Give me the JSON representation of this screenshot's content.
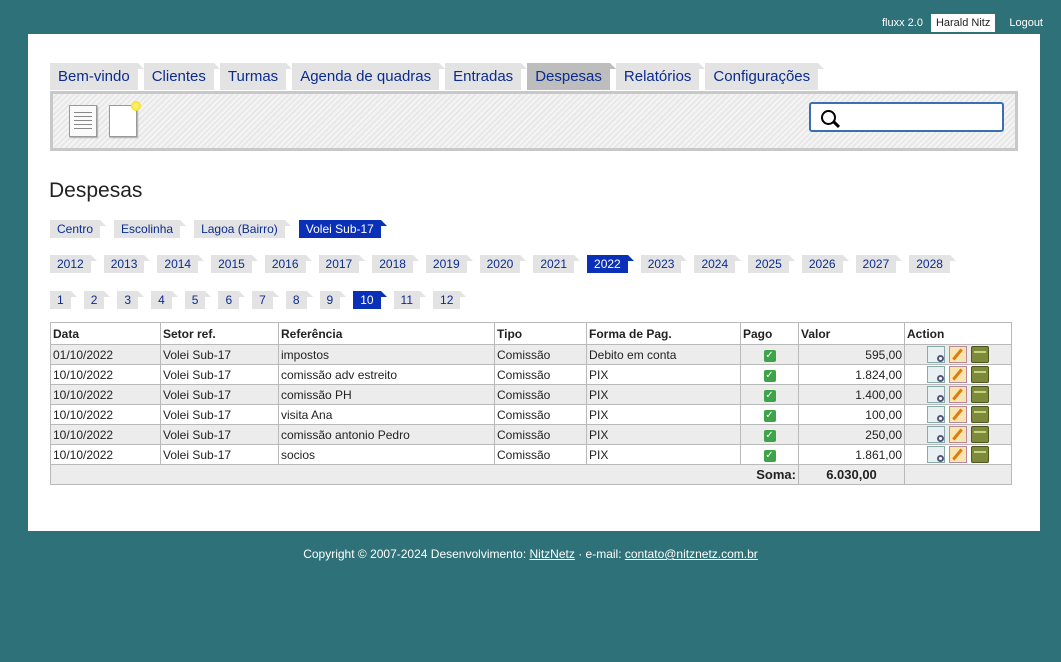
{
  "topbar": {
    "brand": "fluxx 2.0",
    "user": "Harald Nitz",
    "logout": "Logout"
  },
  "tabs": [
    {
      "label": "Bem-vindo",
      "active": false
    },
    {
      "label": "Clientes",
      "active": false
    },
    {
      "label": "Turmas",
      "active": false
    },
    {
      "label": "Agenda de quadras",
      "active": false
    },
    {
      "label": "Entradas",
      "active": false
    },
    {
      "label": "Despesas",
      "active": true
    },
    {
      "label": "Relatórios",
      "active": false
    },
    {
      "label": "Configurações",
      "active": false
    }
  ],
  "toolbar": {
    "list_icon": "document-list-icon",
    "new_icon": "new-document-icon",
    "search_icon": "magnifier-icon",
    "search_value": ""
  },
  "page_title": "Despesas",
  "sectors": [
    {
      "label": "Centro",
      "active": false
    },
    {
      "label": "Escolinha",
      "active": false
    },
    {
      "label": "Lagoa (Bairro)",
      "active": false
    },
    {
      "label": "Volei Sub-17",
      "active": true
    }
  ],
  "years": [
    {
      "label": "2012",
      "active": false
    },
    {
      "label": "2013",
      "active": false
    },
    {
      "label": "2014",
      "active": false
    },
    {
      "label": "2015",
      "active": false
    },
    {
      "label": "2016",
      "active": false
    },
    {
      "label": "2017",
      "active": false
    },
    {
      "label": "2018",
      "active": false
    },
    {
      "label": "2019",
      "active": false
    },
    {
      "label": "2020",
      "active": false
    },
    {
      "label": "2021",
      "active": false
    },
    {
      "label": "2022",
      "active": true
    },
    {
      "label": "2023",
      "active": false
    },
    {
      "label": "2024",
      "active": false
    },
    {
      "label": "2025",
      "active": false
    },
    {
      "label": "2026",
      "active": false
    },
    {
      "label": "2027",
      "active": false
    },
    {
      "label": "2028",
      "active": false
    }
  ],
  "months": [
    {
      "label": "1",
      "active": false
    },
    {
      "label": "2",
      "active": false
    },
    {
      "label": "3",
      "active": false
    },
    {
      "label": "4",
      "active": false
    },
    {
      "label": "5",
      "active": false
    },
    {
      "label": "6",
      "active": false
    },
    {
      "label": "7",
      "active": false
    },
    {
      "label": "8",
      "active": false
    },
    {
      "label": "9",
      "active": false
    },
    {
      "label": "10",
      "active": true
    },
    {
      "label": "11",
      "active": false
    },
    {
      "label": "12",
      "active": false
    }
  ],
  "table": {
    "headers": [
      "Data",
      "Setor ref.",
      "Referência",
      "Tipo",
      "Forma de Pag.",
      "Pago",
      "Valor",
      "Action"
    ],
    "rows": [
      {
        "data": "01/10/2022",
        "setor": "Volei Sub-17",
        "referencia": "impostos",
        "tipo": "Comissão",
        "forma": "Debito em conta",
        "pago": true,
        "valor": "595,00"
      },
      {
        "data": "10/10/2022",
        "setor": "Volei Sub-17",
        "referencia": "comissão adv estreito",
        "tipo": "Comissão",
        "forma": "PIX",
        "pago": true,
        "valor": "1.824,00"
      },
      {
        "data": "10/10/2022",
        "setor": "Volei Sub-17",
        "referencia": "comissão PH",
        "tipo": "Comissão",
        "forma": "PIX",
        "pago": true,
        "valor": "1.400,00"
      },
      {
        "data": "10/10/2022",
        "setor": "Volei Sub-17",
        "referencia": "visita Ana",
        "tipo": "Comissão",
        "forma": "PIX",
        "pago": true,
        "valor": "100,00"
      },
      {
        "data": "10/10/2022",
        "setor": "Volei Sub-17",
        "referencia": "comissão antonio Pedro",
        "tipo": "Comissão",
        "forma": "PIX",
        "pago": true,
        "valor": "250,00"
      },
      {
        "data": "10/10/2022",
        "setor": "Volei Sub-17",
        "referencia": "socios",
        "tipo": "Comissão",
        "forma": "PIX",
        "pago": true,
        "valor": "1.861,00"
      }
    ],
    "actions": [
      "view-icon",
      "edit-icon",
      "archive-icon"
    ],
    "total_label": "Soma:",
    "total_value": "6.030,00"
  },
  "footer": {
    "prefix": "Copyright © 2007-2024 Desenvolvimento: ",
    "dev_link": "NitzNetz",
    "mid": " · e-mail: ",
    "email_link": "contato@nitznetz.com.br"
  },
  "colors": {
    "background": "#2e7178",
    "accent": "#0a30b8",
    "link": "#0b2c8f"
  }
}
